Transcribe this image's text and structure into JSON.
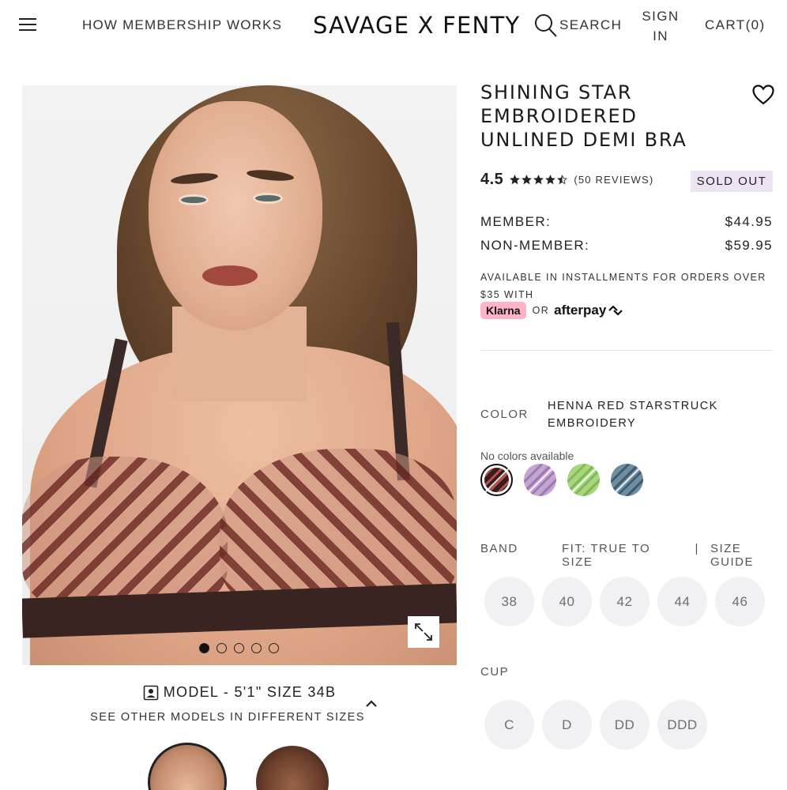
{
  "header": {
    "nav_membership": "HOW MEMBERSHIP WORKS",
    "logo": "SAVAGE X FENTY",
    "search_label": "SEARCH",
    "signin_line1": "SIGN",
    "signin_line2": "IN",
    "cart_label": "CART(0)"
  },
  "gallery": {
    "dots_total": 5,
    "active_dot": 1
  },
  "model": {
    "info": "MODEL - 5'1\" SIZE 34B",
    "see_other": "SEE OTHER MODELS IN DIFFERENT SIZES"
  },
  "product": {
    "title": "SHINING STAR EMBROIDERED UNLINED DEMI BRA",
    "rating": "4.5",
    "rating_value": 4.5,
    "rating_max": 5,
    "reviews": "(50 REVIEWS)",
    "status": "SOLD OUT",
    "member_label": "MEMBER:",
    "member_price": "$44.95",
    "nonmember_label": "NON-MEMBER:",
    "nonmember_price": "$59.95",
    "installments": "AVAILABLE IN INSTALLMENTS FOR ORDERS OVER $35 WITH",
    "klarna": "Klarna",
    "or": "OR",
    "afterpay": "afterpay"
  },
  "color": {
    "label": "COLOR",
    "name": "HENNA RED STARSTRUCK EMBROIDERY",
    "no_colors": "No colors available",
    "swatches": [
      {
        "name": "henna-red",
        "color": "#3a1c1e",
        "accent": "#b4534a",
        "selected": true
      },
      {
        "name": "lilac",
        "color": "#c6a4d2",
        "accent": "#9b7ab2",
        "selected": false
      },
      {
        "name": "lime",
        "color": "#a9d67c",
        "accent": "#7fb85a",
        "selected": false
      },
      {
        "name": "blue-gray",
        "color": "#6e8ea3",
        "accent": "#3f5b6c",
        "selected": false
      }
    ]
  },
  "band": {
    "label": "BAND",
    "fit": "FIT: TRUE TO SIZE",
    "separator": "|",
    "size_guide": "SIZE GUIDE",
    "sizes": [
      "38",
      "40",
      "42",
      "44",
      "46"
    ]
  },
  "cup": {
    "label": "CUP",
    "sizes": [
      "C",
      "D",
      "DD",
      "DDD"
    ]
  }
}
